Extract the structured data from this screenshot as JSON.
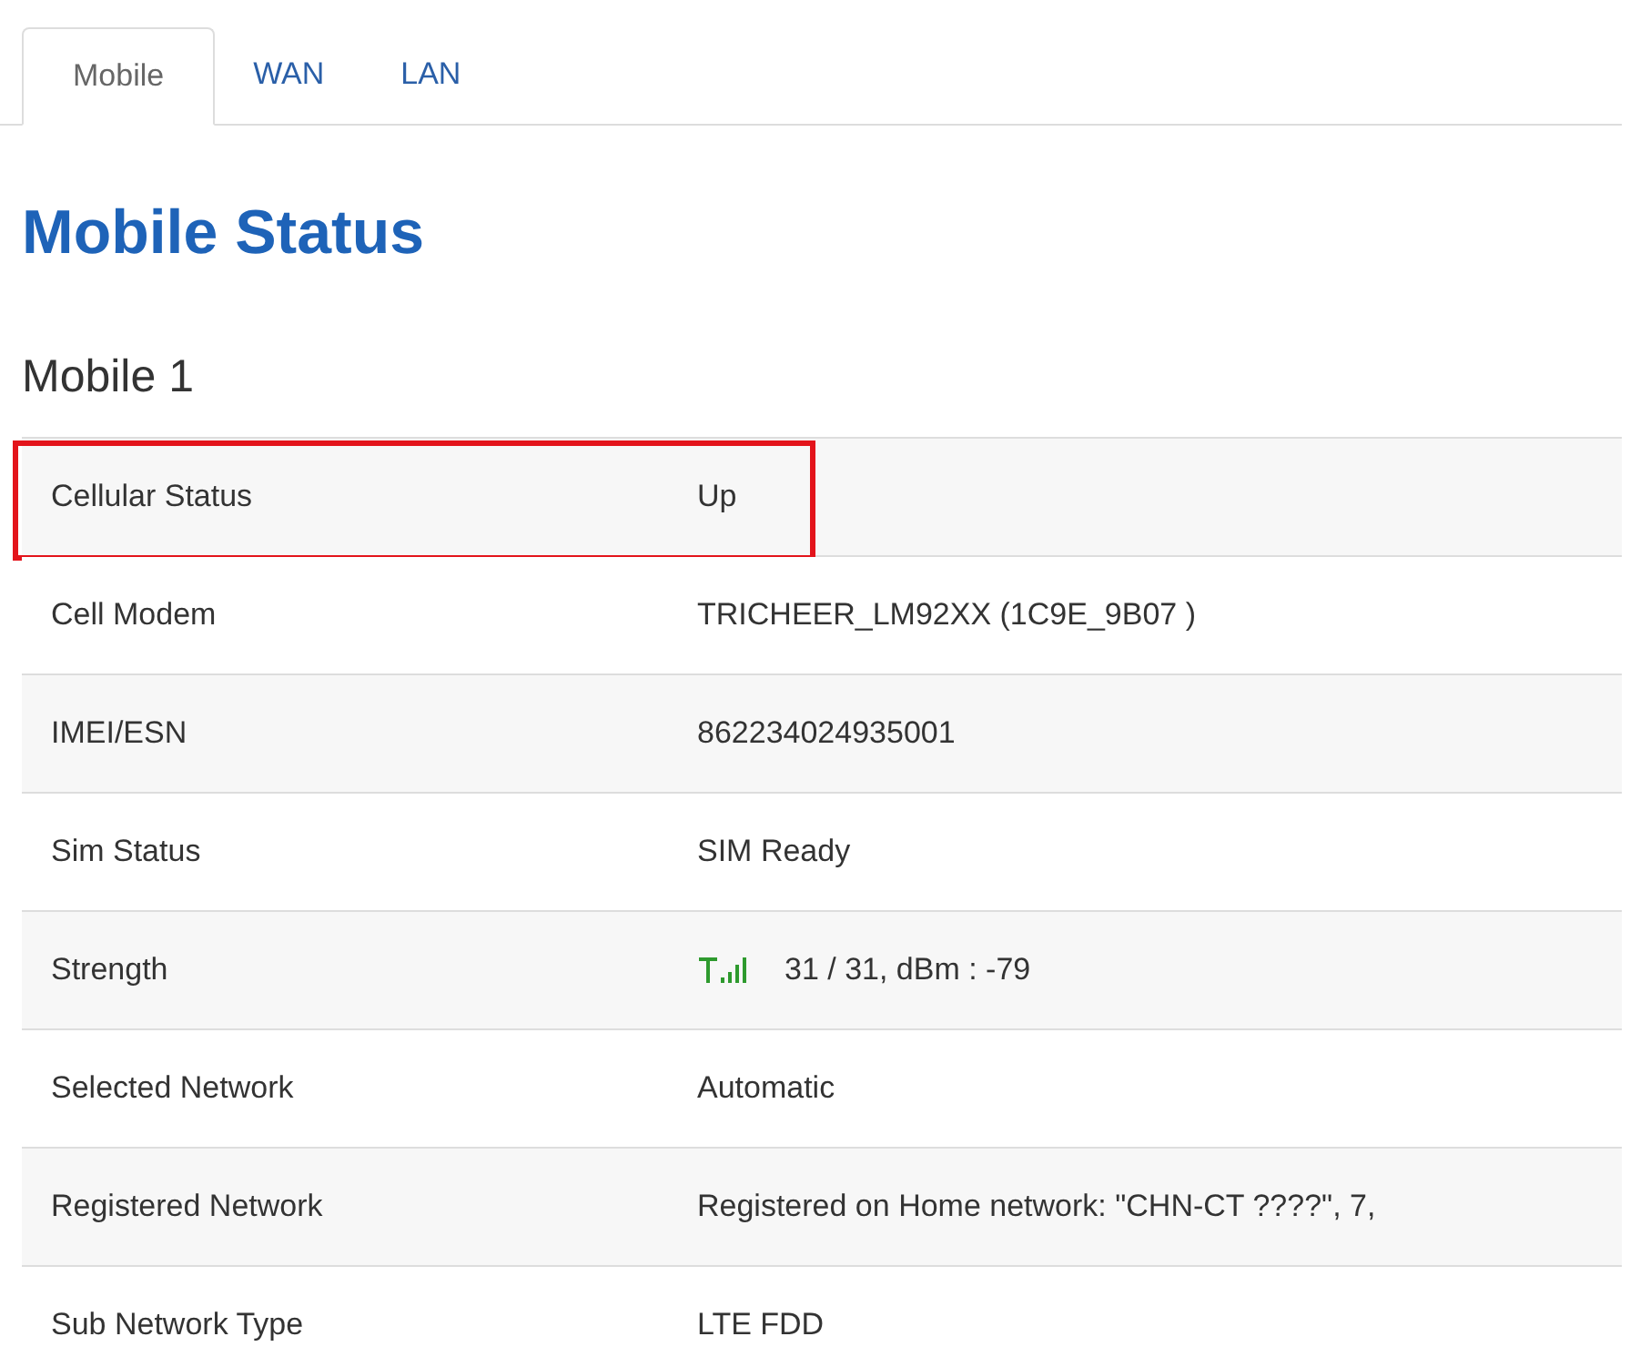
{
  "tabs": [
    {
      "label": "Mobile",
      "selected": true
    },
    {
      "label": "WAN",
      "selected": false
    },
    {
      "label": "LAN",
      "selected": false
    }
  ],
  "heading": "Mobile Status",
  "section": "Mobile 1",
  "rows": [
    {
      "label": "Cellular Status",
      "value": "Up",
      "highlighted": true
    },
    {
      "label": "Cell Modem",
      "value": "TRICHEER_LM92XX (1C9E_9B07 )",
      "highlighted": false
    },
    {
      "label": "IMEI/ESN",
      "value": "862234024935001",
      "highlighted": false
    },
    {
      "label": "Sim Status",
      "value": "SIM Ready",
      "highlighted": false
    },
    {
      "label": "Strength",
      "value": "31 / 31, dBm : -79",
      "highlighted": false,
      "kind": "signal"
    },
    {
      "label": "Selected Network",
      "value": "Automatic",
      "highlighted": false
    },
    {
      "label": "Registered Network",
      "value": "Registered on Home network: \"CHN-CT ????\", 7,",
      "highlighted": false
    },
    {
      "label": "Sub Network Type",
      "value": "LTE FDD",
      "highlighted": false
    }
  ]
}
